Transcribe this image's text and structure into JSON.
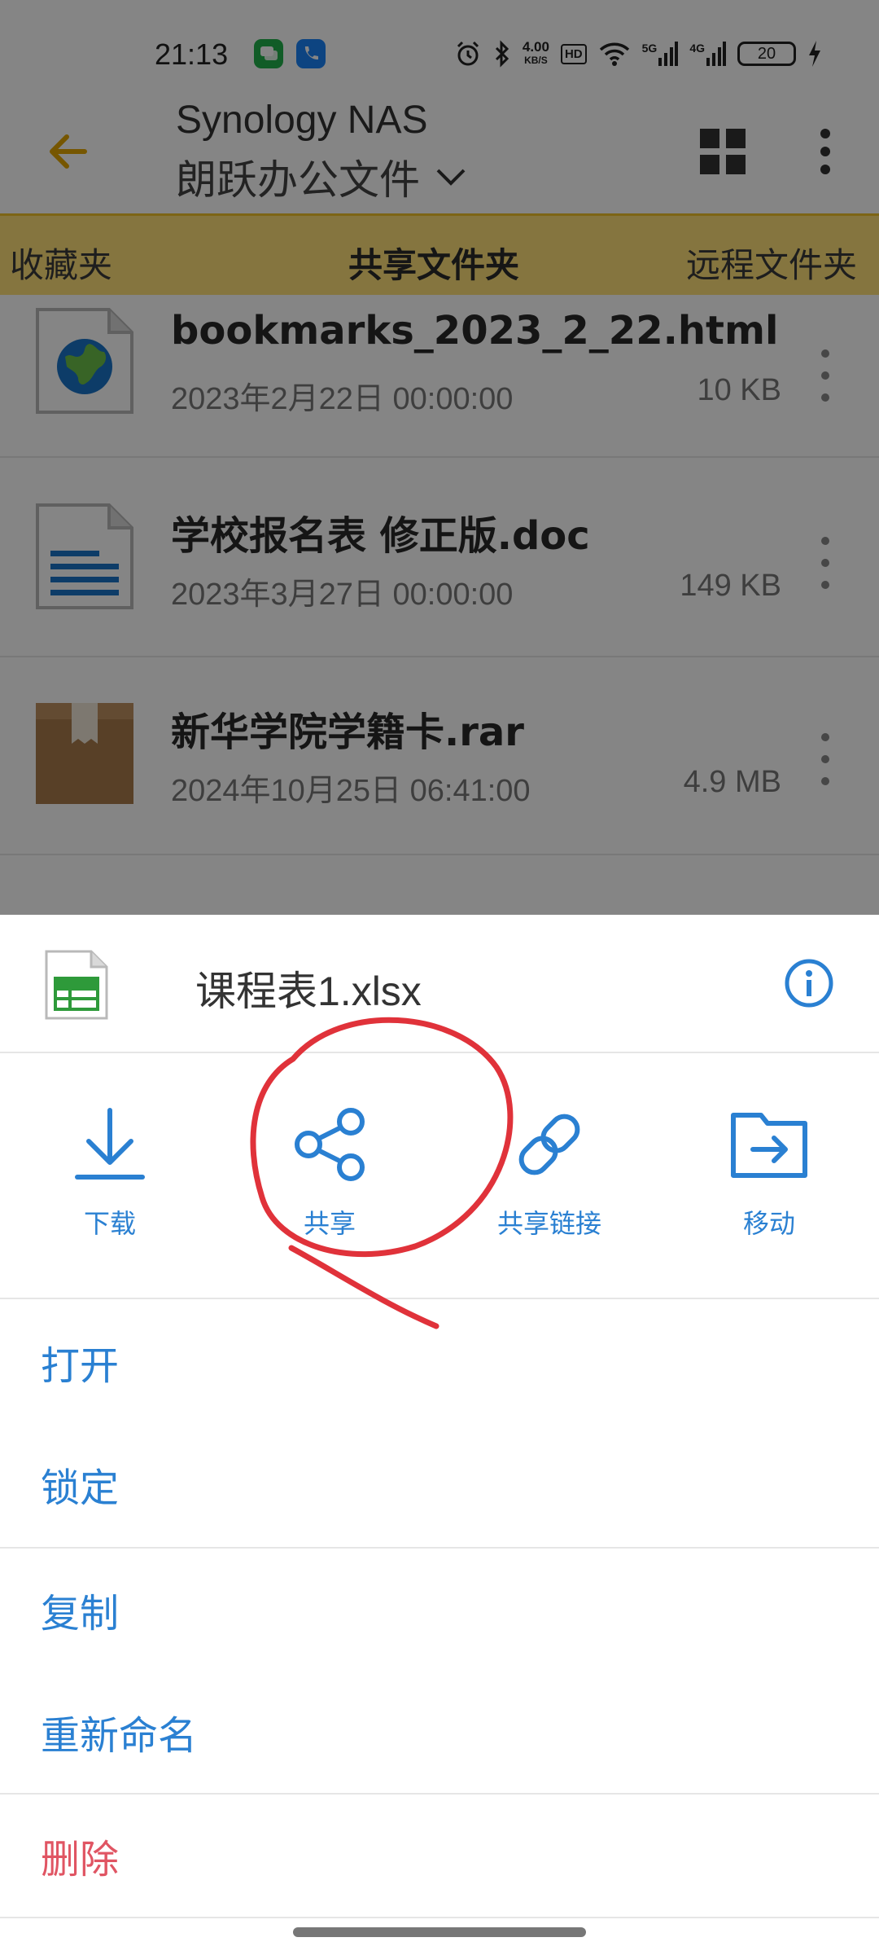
{
  "status_bar": {
    "time": "21:13",
    "speed_value": "4.00",
    "speed_unit": "KB/S",
    "hd": "HD",
    "net1": "5G",
    "net2": "4G",
    "battery": "20"
  },
  "toolbar": {
    "title": "Synology NAS",
    "subtitle": "朗跃办公文件"
  },
  "tabs": [
    "收藏夹",
    "共享文件夹",
    "远程文件夹"
  ],
  "files": [
    {
      "name": "bookmarks_2023_2_22.html",
      "date": "2023年2月22日 00:00:00",
      "size": "10 KB",
      "icon": "globe-file-icon"
    },
    {
      "name": "学校报名表 修正版.doc",
      "date": "2023年3月27日 00:00:00",
      "size": "149 KB",
      "icon": "document-file-icon"
    },
    {
      "name": "新华学院学籍卡.rar",
      "date": "2024年10月25日 06:41:00",
      "size": "4.9 MB",
      "icon": "archive-box-icon"
    }
  ],
  "sheet": {
    "file_name": "课程表1.xlsx",
    "file_icon": "spreadsheet-file-icon",
    "actions": [
      {
        "label": "下载",
        "icon": "download-icon"
      },
      {
        "label": "共享",
        "icon": "share-icon"
      },
      {
        "label": "共享链接",
        "icon": "link-icon"
      },
      {
        "label": "移动",
        "icon": "move-folder-icon"
      }
    ],
    "menu": [
      {
        "label": "打开"
      },
      {
        "label": "锁定"
      },
      {
        "label": "复制"
      },
      {
        "label": "重新命名"
      },
      {
        "label": "删除"
      }
    ]
  },
  "colors": {
    "accent_blue": "#2a80d2",
    "danger_red": "#e05563",
    "tab_bar": "#ffe17a",
    "tab_indicator": "#e3a600",
    "annotation_red": "#e0323a"
  }
}
